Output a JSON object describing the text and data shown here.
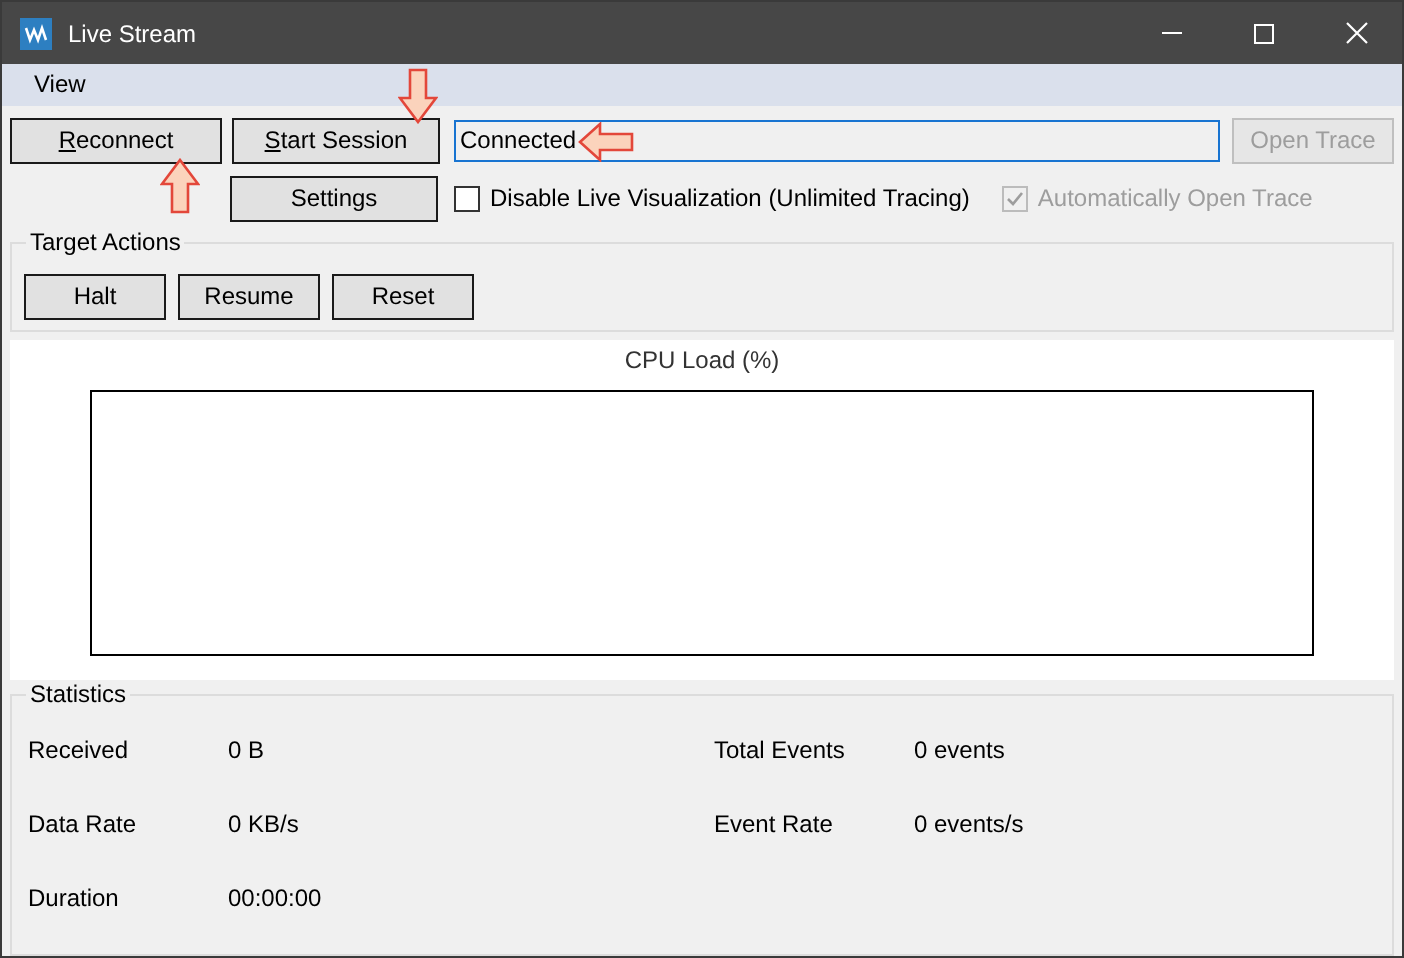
{
  "window": {
    "title": "Live Stream"
  },
  "menu": [
    {
      "label": "View"
    }
  ],
  "buttons_row1": [
    {
      "label": "Reconnect",
      "mnemonic": true,
      "disabled": false
    },
    {
      "label": "Start Session",
      "mnemonic": true,
      "disabled": false
    }
  ],
  "status_field": {
    "value": "Connected"
  },
  "open_trace_button": {
    "label": "Open Trace",
    "disabled": true
  },
  "settings_button": {
    "label": "Settings",
    "disabled": false
  },
  "options": [
    {
      "label": "Disable Live Visualization (Unlimited Tracing)",
      "checked": false,
      "disabled": false
    },
    {
      "label": "Automatically Open Trace",
      "checked": true,
      "disabled": true
    }
  ],
  "target_actions": {
    "title": "Target Actions",
    "buttons": [
      {
        "label": "Halt"
      },
      {
        "label": "Resume"
      },
      {
        "label": "Reset"
      }
    ]
  },
  "cpu_chart": {
    "title": "CPU Load (%)"
  },
  "statistics": {
    "title": "Statistics",
    "items": [
      {
        "label": "Received",
        "value": "0 B"
      },
      {
        "label": "Total Events",
        "value": "0 events"
      },
      {
        "label": "Data Rate",
        "value": "0 KB/s"
      },
      {
        "label": "Event Rate",
        "value": "0 events/s"
      },
      {
        "label": "Duration",
        "value": "00:00:00"
      }
    ]
  }
}
